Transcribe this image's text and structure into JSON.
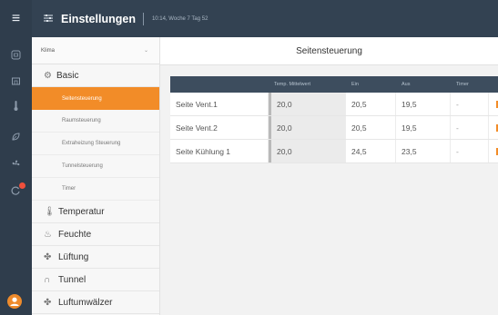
{
  "app": {
    "title": "Einstellungen",
    "subtitle": "10:14, Woche 7 Tag 52"
  },
  "sidebar": {
    "house_select": {
      "value": "Klima"
    },
    "group": {
      "label": "Basic"
    },
    "sub_items": [
      {
        "label": "Seitensteuerung",
        "active": true
      },
      {
        "label": "Raumsteuerung",
        "active": false
      },
      {
        "label": "Extraheizung Steuerung",
        "active": false
      },
      {
        "label": "Tunnelsteuerung",
        "active": false
      },
      {
        "label": "Timer",
        "active": false
      }
    ],
    "categories": [
      {
        "label": "Temperatur",
        "icon": "thermometer-icon"
      },
      {
        "label": "Feuchte",
        "icon": "humidity-icon"
      },
      {
        "label": "Lüftung",
        "icon": "fan-icon"
      },
      {
        "label": "Tunnel",
        "icon": "tunnel-icon"
      },
      {
        "label": "Luftumwälzer",
        "icon": "fan-icon"
      }
    ]
  },
  "main": {
    "title": "Seitensteuerung",
    "table": {
      "columns": [
        "",
        "Temp. Mittelwert",
        "Ein",
        "Aus",
        "Timer"
      ],
      "rows": [
        {
          "name": "Seite Vent.1",
          "temp": "20,0",
          "on": "20,5",
          "off": "19,5",
          "timer": "-"
        },
        {
          "name": "Seite Vent.2",
          "temp": "20,0",
          "on": "20,5",
          "off": "19,5",
          "timer": "-"
        },
        {
          "name": "Seite Kühlung 1",
          "temp": "20,0",
          "on": "24,5",
          "off": "23,5",
          "timer": "-"
        }
      ]
    }
  },
  "colors": {
    "topbar": "#334252",
    "rail": "#2f3d4c",
    "accent": "#f28c28",
    "table_header": "#3d4d5e",
    "alert_dot": "#f0503c"
  }
}
